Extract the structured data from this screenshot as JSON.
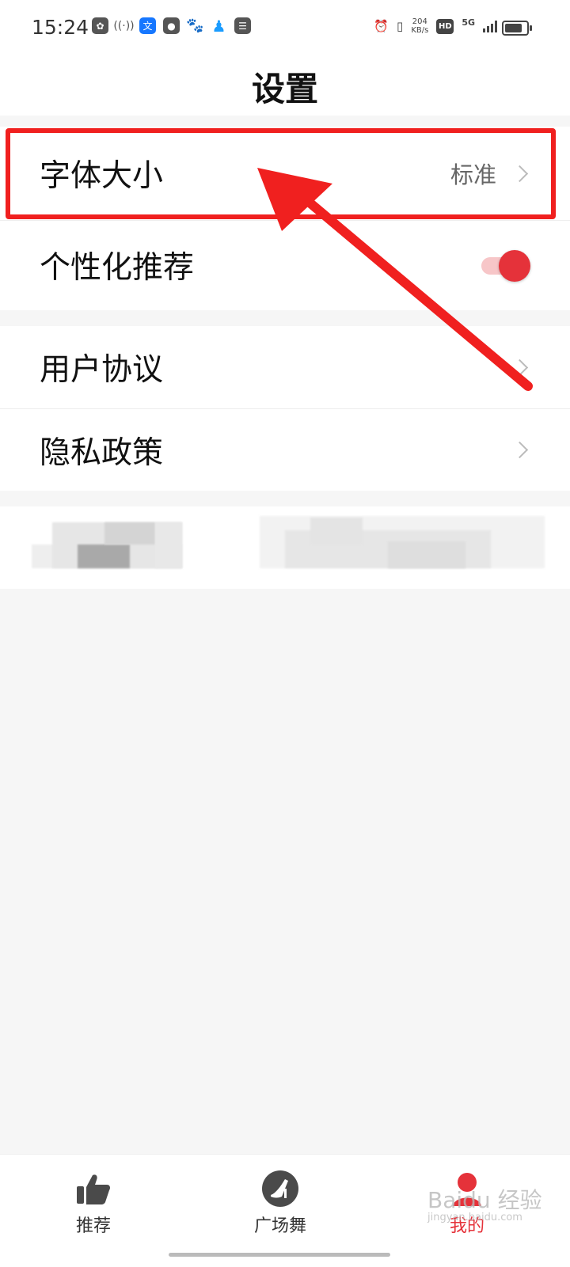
{
  "status_bar": {
    "time": "15:24",
    "left_icons": [
      "app-icon",
      "hotspot-icon",
      "translate-icon",
      "map-pin-icon",
      "baidu-icon",
      "qq-icon",
      "calendar-icon"
    ],
    "right_icons": [
      "alarm-icon",
      "vibrate-icon",
      "hd-icon",
      "signal-5g-icon",
      "battery-icon"
    ],
    "net_speed_value": "204",
    "net_speed_unit": "KB/s",
    "hd": "HD",
    "network": "5G"
  },
  "header": {
    "title": "设置"
  },
  "settings": {
    "font_size": {
      "label": "字体大小",
      "value": "标准"
    },
    "personalized": {
      "label": "个性化推荐",
      "enabled": true
    },
    "user_agreement": {
      "label": "用户协议"
    },
    "privacy_policy": {
      "label": "隐私政策"
    }
  },
  "annotation": {
    "color": "#f0201f"
  },
  "tabs": [
    {
      "label": "推荐",
      "icon": "thumbs-up-icon",
      "active": false
    },
    {
      "label": "广场舞",
      "icon": "high-heel-icon",
      "active": false
    },
    {
      "label": "我的",
      "icon": "user-icon",
      "active": true
    }
  ],
  "watermark": {
    "text": "Baidu 经验",
    "sub": "jingyan.baidu.com"
  },
  "colors": {
    "accent": "#e5323a",
    "background": "#f6f6f6"
  }
}
